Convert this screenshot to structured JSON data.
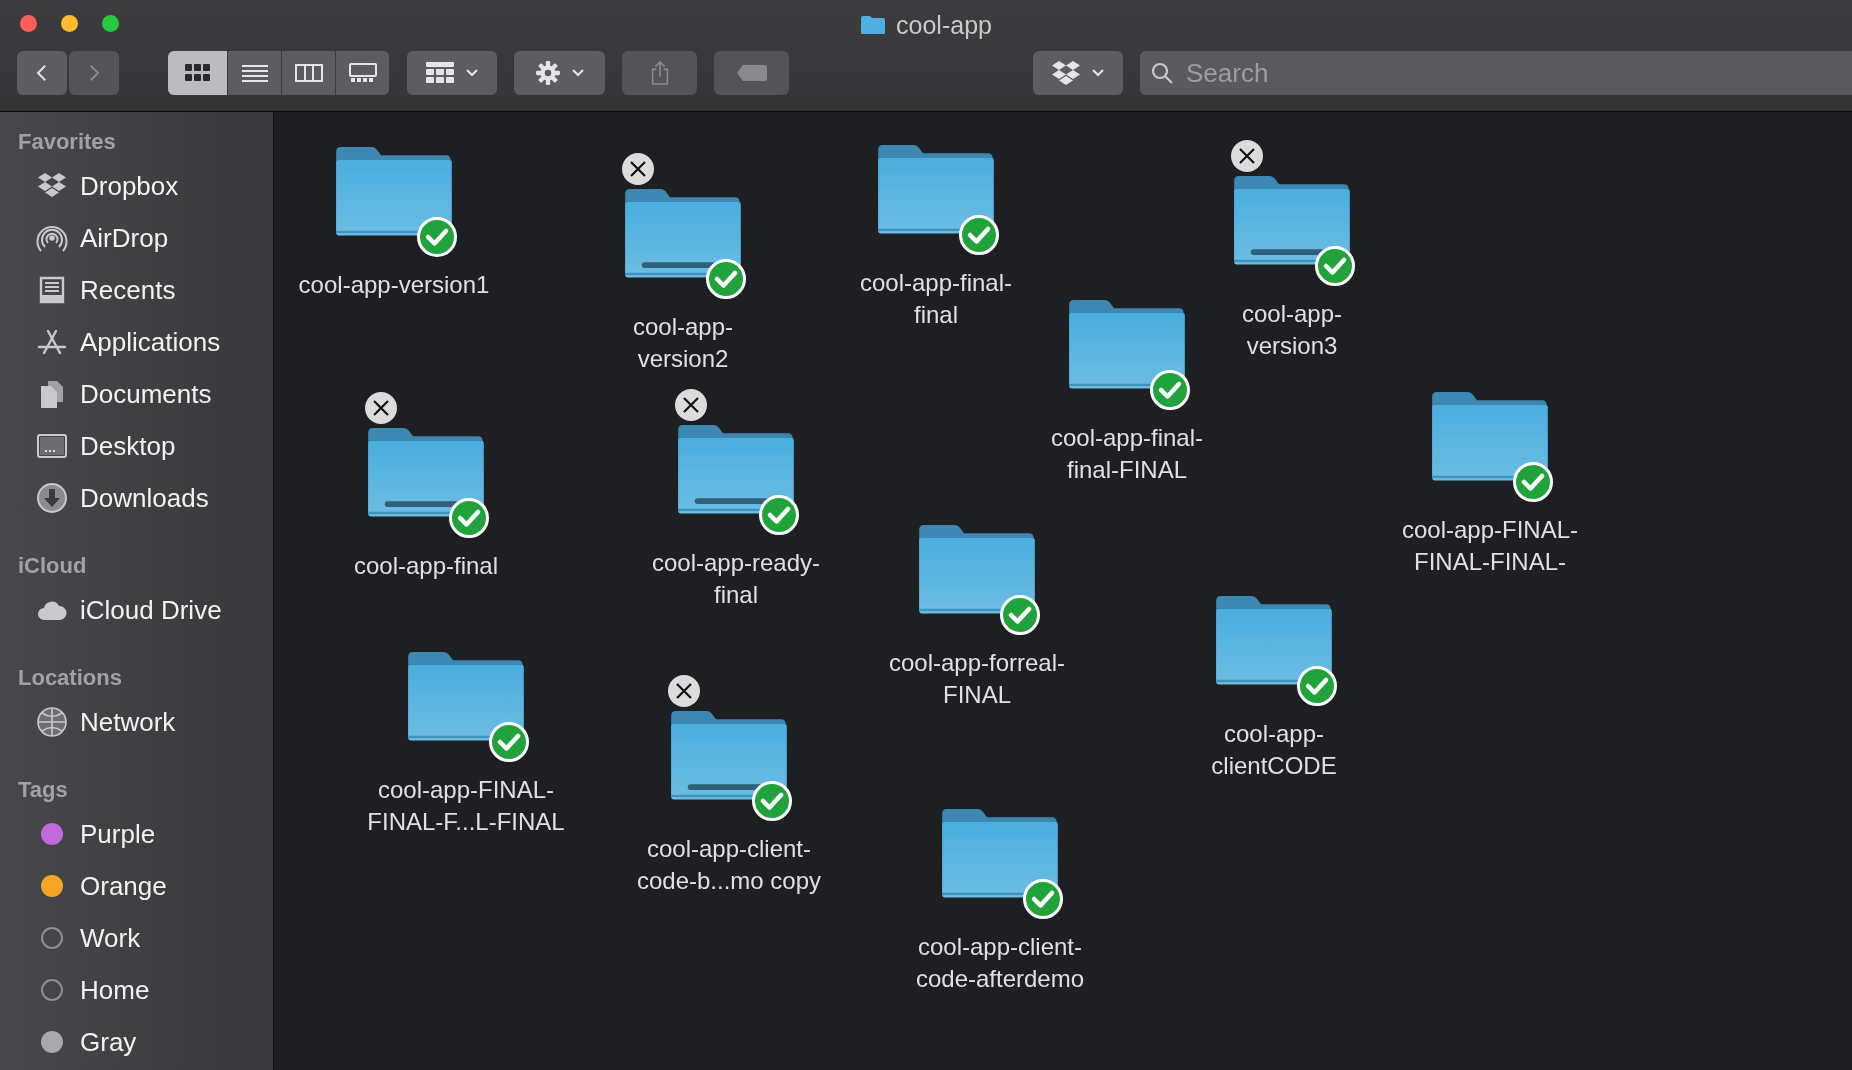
{
  "window": {
    "title": "cool-app"
  },
  "toolbar": {
    "nav": [
      {
        "kind": "back",
        "disabled": false
      },
      {
        "kind": "forward",
        "disabled": true
      }
    ],
    "view_modes": [
      {
        "kind": "icons",
        "selected": true
      },
      {
        "kind": "list",
        "selected": false
      },
      {
        "kind": "columns",
        "selected": false
      },
      {
        "kind": "gallery",
        "selected": false
      }
    ],
    "buttons": [
      {
        "kind": "group",
        "disabled": false
      },
      {
        "kind": "action",
        "disabled": false
      },
      {
        "kind": "share",
        "disabled": true
      },
      {
        "kind": "tags",
        "disabled": true
      }
    ],
    "dropbox_button": {
      "disabled": false
    },
    "search": {
      "placeholder": "Search"
    }
  },
  "sidebar": [
    {
      "title": "Favorites",
      "items": [
        {
          "label": "Dropbox"
        },
        {
          "label": "AirDrop"
        },
        {
          "label": "Recents"
        },
        {
          "label": "Applications"
        },
        {
          "label": "Documents"
        },
        {
          "label": "Desktop"
        },
        {
          "label": "Downloads"
        }
      ]
    },
    {
      "title": "iCloud",
      "items": [
        {
          "label": "iCloud Drive"
        }
      ]
    },
    {
      "title": "Locations",
      "items": [
        {
          "label": "Network"
        }
      ]
    },
    {
      "title": "Tags",
      "items": [
        {
          "label": "Purple",
          "color": "#c26adb",
          "outline": false
        },
        {
          "label": "Orange",
          "color": "#f5a623",
          "outline": false
        },
        {
          "label": "Work",
          "color": "#8e8e93",
          "outline": true
        },
        {
          "label": "Home",
          "color": "#8e8e93",
          "outline": true
        },
        {
          "label": "Gray",
          "color": "#a8a8ad",
          "outline": false
        }
      ]
    }
  ],
  "folders": [
    {
      "label": "cool-app-version1",
      "closable": false,
      "synced": true
    },
    {
      "label": "cool-app-\nversion2",
      "closable": true,
      "synced": true
    },
    {
      "label": "cool-app-final-\nfinal",
      "closable": false,
      "synced": true
    },
    {
      "label": "cool-app-\nversion3",
      "closable": true,
      "synced": true
    },
    {
      "label": "cool-app-final-\nfinal-FINAL",
      "closable": false,
      "synced": true
    },
    {
      "label": "cool-app-FINAL-\nFINAL-FINAL-",
      "closable": false,
      "synced": true
    },
    {
      "label": "cool-app-final",
      "closable": true,
      "synced": true
    },
    {
      "label": "cool-app-ready-\nfinal",
      "closable": true,
      "synced": true
    },
    {
      "label": "cool-app-forreal-\nFINAL",
      "closable": false,
      "synced": true
    },
    {
      "label": "cool-app-\nclientCODE",
      "closable": false,
      "synced": true
    },
    {
      "label": "cool-app-FINAL-\nFINAL-F...L-FINAL",
      "closable": false,
      "synced": true
    },
    {
      "label": "cool-app-client-\ncode-b...mo copy",
      "closable": true,
      "synced": true
    },
    {
      "label": "cool-app-client-\ncode-afterdemo",
      "closable": false,
      "synced": true
    }
  ]
}
